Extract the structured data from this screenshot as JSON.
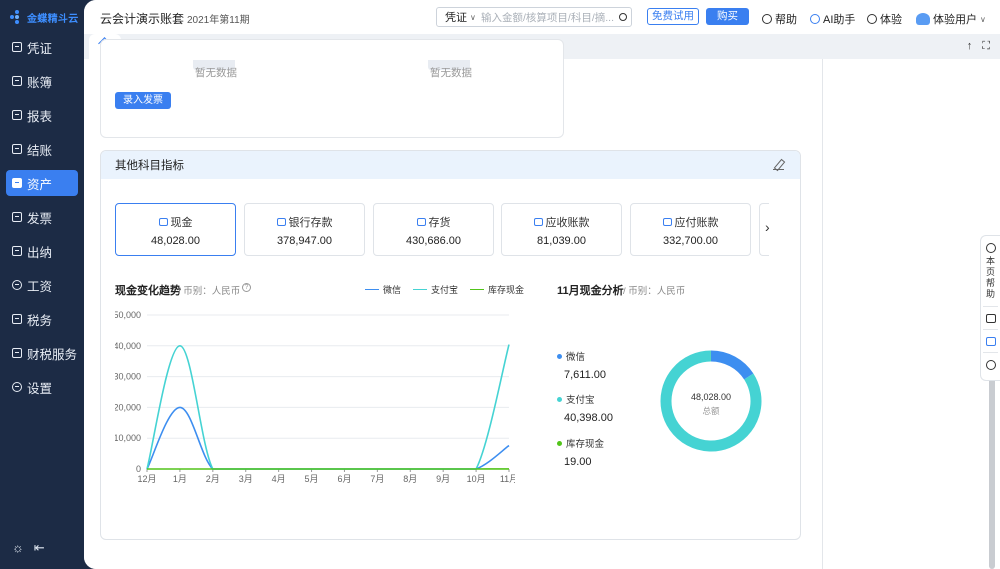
{
  "logo": {
    "text": "金蝶精斗云"
  },
  "sidebar": {
    "items": [
      {
        "label": "凭证",
        "icon": "voucher-icon"
      },
      {
        "label": "账簿",
        "icon": "ledger-icon"
      },
      {
        "label": "报表",
        "icon": "report-icon"
      },
      {
        "label": "结账",
        "icon": "close-book-icon"
      },
      {
        "label": "资产",
        "icon": "asset-icon",
        "active": true
      },
      {
        "label": "发票",
        "icon": "invoice-icon"
      },
      {
        "label": "出纳",
        "icon": "cashier-icon"
      },
      {
        "label": "工资",
        "icon": "salary-icon"
      },
      {
        "label": "税务",
        "icon": "tax-icon"
      },
      {
        "label": "财税服务",
        "icon": "finance-service-icon"
      },
      {
        "label": "设置",
        "icon": "settings-icon"
      }
    ],
    "bottom": {
      "theme_icon": "sun-icon",
      "collapse_icon": "collapse-icon"
    }
  },
  "header": {
    "account_set": "云会计演示账套",
    "period": "2021年第11期",
    "search": {
      "type": "凭证",
      "placeholder": "输入金额/核算项目/科目/摘..."
    },
    "trial_button": "免费试用",
    "buy_button": "购买",
    "help": "帮助",
    "ai": "AI助手",
    "experience": "体验",
    "user": "体验用户"
  },
  "invoice_card": {
    "empty_left": "暂无数据",
    "empty_right": "暂无数据",
    "enter_button": "录入发票"
  },
  "panel": {
    "title": "其他科目指标",
    "metrics": [
      {
        "label": "现金",
        "value": "48,028.00"
      },
      {
        "label": "银行存款",
        "value": "378,947.00"
      },
      {
        "label": "存货",
        "value": "430,686.00"
      },
      {
        "label": "应收账款",
        "value": "81,039.00"
      },
      {
        "label": "应付账款",
        "value": "332,700.00"
      }
    ],
    "trend_title": "现金变化趋势",
    "trend_currency": "/ 币别：人民币",
    "analysis_title": "11月现金分析",
    "analysis_currency": "/ 币别：人民币"
  },
  "colors": {
    "wechat": "#3d8ef0",
    "alipay": "#45d3d3",
    "cash": "#52c41a",
    "accent": "#3a7ff0"
  },
  "chart_data": [
    {
      "type": "line",
      "title": "现金变化趋势",
      "x": [
        "12月",
        "1月",
        "2月",
        "3月",
        "4月",
        "5月",
        "6月",
        "7月",
        "8月",
        "9月",
        "10月",
        "11月"
      ],
      "ylim": [
        0,
        50000
      ],
      "yticks": [
        "0",
        "10,000",
        "20,000",
        "30,000",
        "40,000",
        "50,000"
      ],
      "series": [
        {
          "name": "微信",
          "color": "#3d8ef0",
          "values": [
            0,
            20000,
            0,
            0,
            0,
            0,
            0,
            0,
            0,
            0,
            0,
            7611
          ]
        },
        {
          "name": "支付宝",
          "color": "#45d3d3",
          "values": [
            0,
            40000,
            0,
            0,
            0,
            0,
            0,
            0,
            0,
            0,
            0,
            40398
          ]
        },
        {
          "name": "库存现金",
          "color": "#52c41a",
          "values": [
            0,
            0,
            0,
            0,
            0,
            0,
            0,
            0,
            0,
            0,
            0,
            19
          ]
        }
      ]
    },
    {
      "type": "pie",
      "title": "11月现金分析",
      "center_value": "48,028.00",
      "center_label": "总额",
      "slices": [
        {
          "name": "微信",
          "value": 7611,
          "label": "7,611.00",
          "color": "#3d8ef0"
        },
        {
          "name": "支付宝",
          "value": 40398,
          "label": "40,398.00",
          "color": "#45d3d3"
        },
        {
          "name": "库存现金",
          "value": 19,
          "label": "19.00",
          "color": "#52c41a"
        }
      ]
    }
  ],
  "help_float": {
    "text": "本页帮助"
  }
}
